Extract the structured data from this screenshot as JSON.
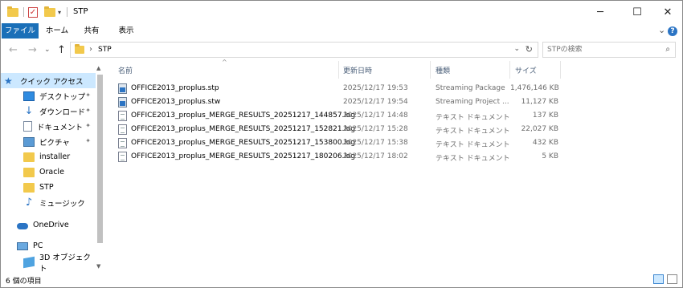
{
  "window": {
    "title": "STP",
    "minimize": "─",
    "maximize": "☐",
    "close": "✕"
  },
  "ribbon": {
    "tabs": [
      "ファイル",
      "ホーム",
      "共有",
      "表示"
    ],
    "expand_glyph": "⌄",
    "help_glyph": "?"
  },
  "nav": {
    "back": "←",
    "forward": "→",
    "recent": "⌄",
    "up": "↑",
    "address_chevron": "›",
    "address_path": "STP",
    "address_dropdown": "⌄",
    "refresh": "↻",
    "search_placeholder": "STPの検索",
    "search_glyph": "⌕"
  },
  "sidebar": {
    "items": [
      {
        "label": "クイック アクセス",
        "icon": "star-icon",
        "pinned": false
      },
      {
        "label": "デスクトップ",
        "icon": "desktop-icon",
        "pinned": true
      },
      {
        "label": "ダウンロード",
        "icon": "download-icon",
        "pinned": true
      },
      {
        "label": "ドキュメント",
        "icon": "document-icon",
        "pinned": true
      },
      {
        "label": "ピクチャ",
        "icon": "pictures-icon",
        "pinned": true
      },
      {
        "label": "installer",
        "icon": "folder-icon",
        "pinned": false
      },
      {
        "label": "Oracle",
        "icon": "folder-icon",
        "pinned": false
      },
      {
        "label": "STP",
        "icon": "folder-icon",
        "pinned": false
      },
      {
        "label": "ミュージック",
        "icon": "music-icon",
        "pinned": false
      },
      {
        "label": "OneDrive",
        "icon": "onedrive-icon",
        "pinned": false
      },
      {
        "label": "PC",
        "icon": "pc-icon",
        "pinned": false
      },
      {
        "label": "3D オブジェクト",
        "icon": "3d-objects-icon",
        "pinned": false
      }
    ],
    "pin_glyph": "📌"
  },
  "filelist": {
    "columns": {
      "name": "名前",
      "date": "更新日時",
      "type": "種類",
      "size": "サイズ"
    },
    "sort_glyph": "^",
    "files": [
      {
        "name": "OFFICE2013_proplus.stp",
        "date": "2025/12/17 19:53",
        "type": "Streaming Package",
        "size": "1,476,146 KB",
        "icon": "stp"
      },
      {
        "name": "OFFICE2013_proplus.stw",
        "date": "2025/12/17 19:54",
        "type": "Streaming Project ...",
        "size": "11,127 KB",
        "icon": "stp"
      },
      {
        "name": "OFFICE2013_proplus_MERGE_RESULTS_20251217_144857.log",
        "date": "2025/12/17 14:48",
        "type": "テキスト ドキュメント",
        "size": "137 KB",
        "icon": "log"
      },
      {
        "name": "OFFICE2013_proplus_MERGE_RESULTS_20251217_152821.log",
        "date": "2025/12/17 15:28",
        "type": "テキスト ドキュメント",
        "size": "22,027 KB",
        "icon": "log"
      },
      {
        "name": "OFFICE2013_proplus_MERGE_RESULTS_20251217_153800.log",
        "date": "2025/12/17 15:38",
        "type": "テキスト ドキュメント",
        "size": "432 KB",
        "icon": "log"
      },
      {
        "name": "OFFICE2013_proplus_MERGE_RESULTS_20251217_180206.log",
        "date": "2025/12/17 18:02",
        "type": "テキスト ドキュメント",
        "size": "5 KB",
        "icon": "log"
      }
    ]
  },
  "statusbar": {
    "item_count": "6 個の項目"
  },
  "colors": {
    "accent": "#1a6fb8",
    "selection": "#cce8ff",
    "header_text": "#4c607a"
  }
}
